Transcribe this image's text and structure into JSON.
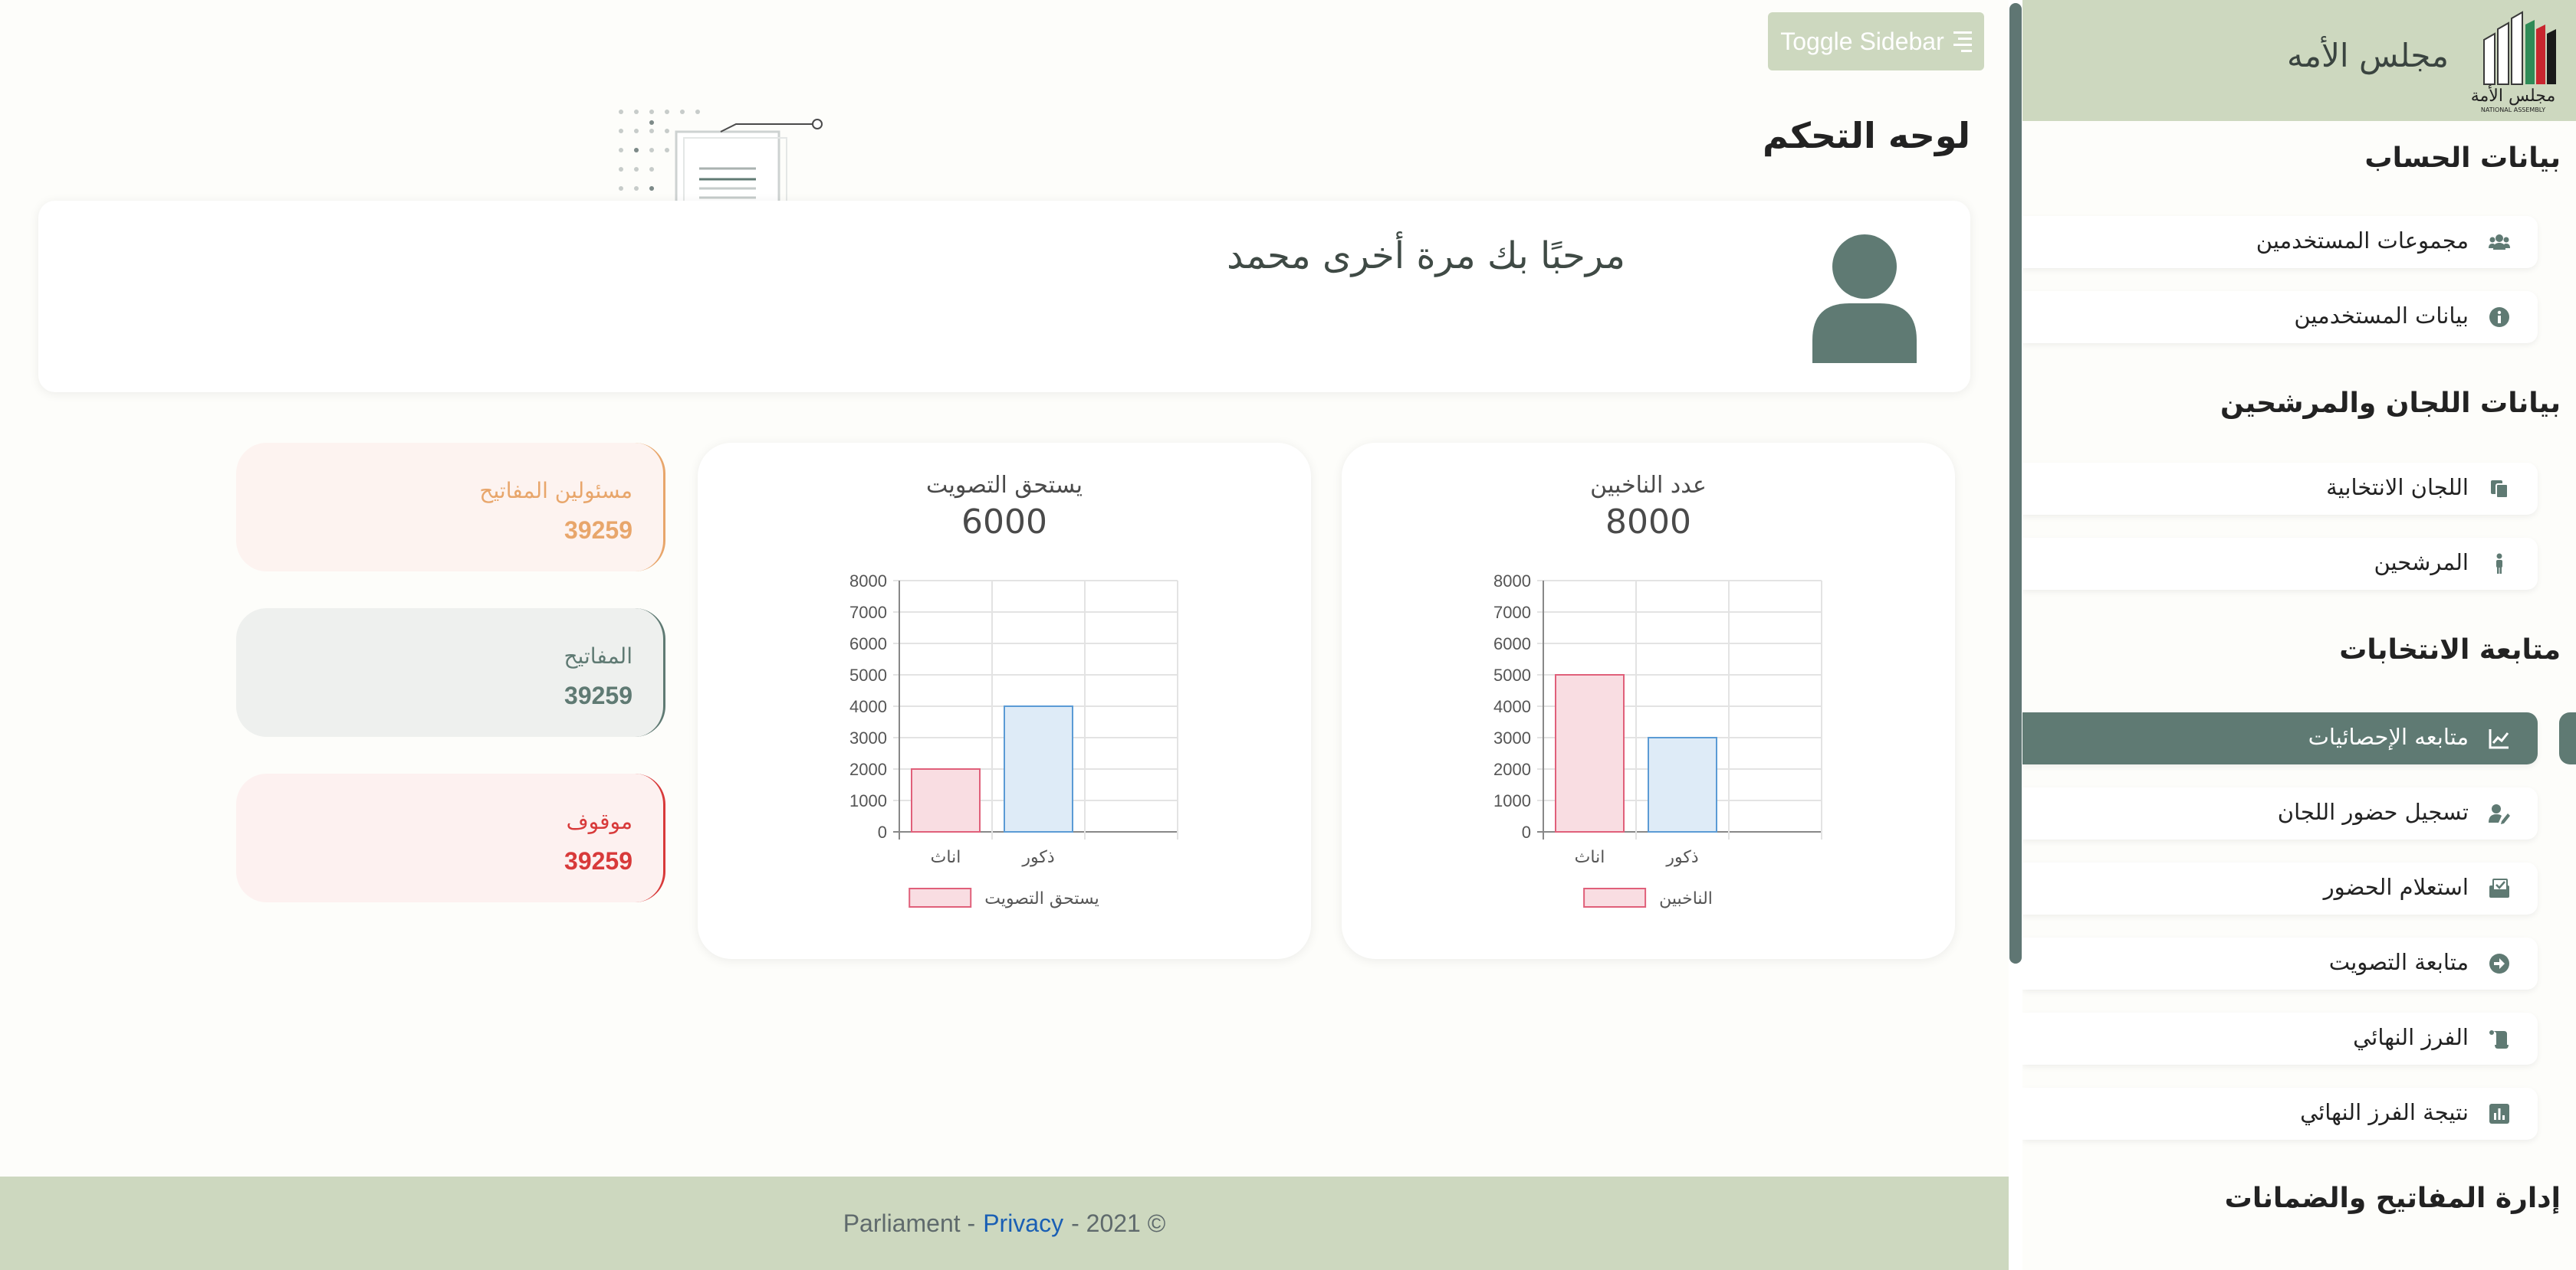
{
  "toggle_label": "Toggle Sidebar",
  "page_title": "لوحه التحكم",
  "welcome": "مرحبًا بك مرة أخرى محمد",
  "charts": [
    {
      "title": "عدد الناخبين",
      "total": "8000",
      "legend": "الناخبين",
      "categories": [
        "اناث",
        "ذكور"
      ],
      "values": [
        5000,
        3000
      ],
      "yticks": [
        "0",
        "1000",
        "2000",
        "3000",
        "4000",
        "5000",
        "6000",
        "7000",
        "8000"
      ]
    },
    {
      "title": "يستحق التصويت",
      "total": "6000",
      "legend": "يستحق التصويت",
      "categories": [
        "اناث",
        "ذكور"
      ],
      "values": [
        2000,
        4000
      ],
      "yticks": [
        "0",
        "1000",
        "2000",
        "3000",
        "4000",
        "5000",
        "6000",
        "7000",
        "8000"
      ]
    }
  ],
  "chart_data": [
    {
      "type": "bar",
      "title": "عدد الناخبين",
      "categories": [
        "اناث",
        "ذكور"
      ],
      "series": [
        {
          "name": "الناخبين",
          "values": [
            5000,
            3000
          ]
        }
      ],
      "ylim": [
        0,
        8000
      ],
      "grid": true,
      "legend": "bottom"
    },
    {
      "type": "bar",
      "title": "يستحق التصويت",
      "categories": [
        "اناث",
        "ذكور"
      ],
      "series": [
        {
          "name": "يستحق التصويت",
          "values": [
            2000,
            4000
          ]
        }
      ],
      "ylim": [
        0,
        8000
      ],
      "grid": true,
      "legend": "bottom"
    }
  ],
  "stats": [
    {
      "label": "مسئولين المفاتيح",
      "value": "39259"
    },
    {
      "label": "المفاتيح",
      "value": "39259"
    },
    {
      "label": "موقوف",
      "value": "39259"
    }
  ],
  "footer": {
    "brand": "Parliament -",
    "privacy": "Privacy",
    "year": "- 2021 ©"
  },
  "sidebar": {
    "brand": "مجلس الأمه",
    "logo_text": "NATIONAL ASSEMBLY",
    "sections": [
      {
        "title": "بيانات الحساب"
      },
      {
        "title": "بيانات اللجان والمرشحين"
      },
      {
        "title": "متابعة الانتخابات"
      },
      {
        "title": "إدارة المفاتيح والضمانات"
      }
    ],
    "items": [
      {
        "label": "مجموعات المستخدمين",
        "icon": "users-icon"
      },
      {
        "label": "بيانات المستخدمين",
        "icon": "info-icon"
      },
      {
        "label": "اللجان الانتخابية",
        "icon": "copy-icon"
      },
      {
        "label": "المرشحين",
        "icon": "person-icon"
      },
      {
        "label": "متابعه الإحصائيات",
        "icon": "chart-line-icon"
      },
      {
        "label": "تسجيل حضور اللجان",
        "icon": "user-edit-icon"
      },
      {
        "label": "استعلام الحضور",
        "icon": "inbox-check-icon"
      },
      {
        "label": "متابعة التصويت",
        "icon": "arrow-circle-icon"
      },
      {
        "label": "الفرز النهائي",
        "icon": "scroll-icon"
      },
      {
        "label": "نتيجة الفرز النهائي",
        "icon": "poll-icon"
      }
    ]
  },
  "colors": {
    "accent": "#5f7a73",
    "header_bg": "#cdd8bf",
    "bar_fill": "#f9dde2",
    "bar_stroke": "#e0607a",
    "bar2_fill": "#deebf7",
    "bar2_stroke": "#5b9bd5",
    "stat1": "#e8a66b",
    "stat2": "#5f7a73",
    "stat3": "#d83a3a"
  }
}
